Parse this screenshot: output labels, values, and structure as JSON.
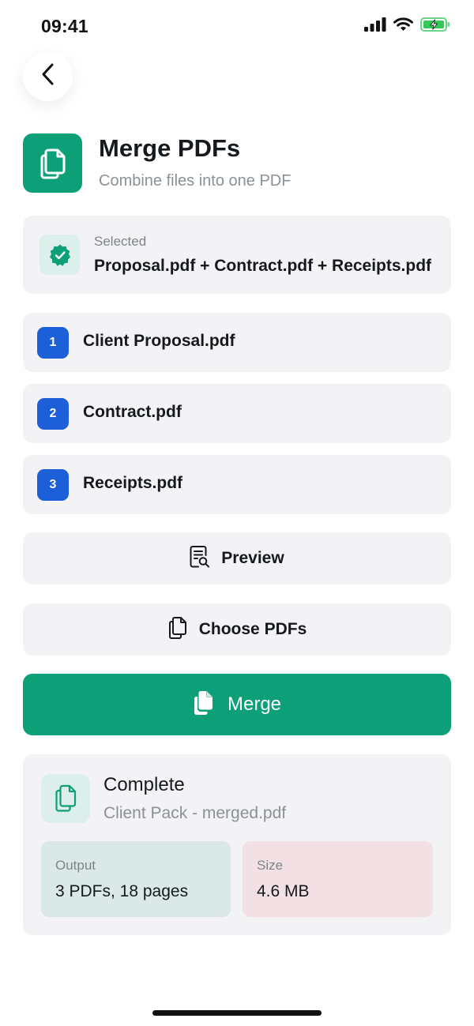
{
  "status_bar": {
    "time": "09:41"
  },
  "header": {
    "title": "Merge PDFs",
    "subtitle": "Combine files into one PDF",
    "icon": "documents-icon"
  },
  "selected": {
    "caption": "Selected",
    "value": "Proposal.pdf + Contract.pdf + Receipts.pdf",
    "icon": "verified-badge-icon"
  },
  "files": [
    {
      "index": "1",
      "name": "Client Proposal.pdf"
    },
    {
      "index": "2",
      "name": "Contract.pdf"
    },
    {
      "index": "3",
      "name": "Receipts.pdf"
    }
  ],
  "actions": {
    "preview_label": "Preview",
    "choose_label": "Choose PDFs",
    "merge_label": "Merge"
  },
  "result": {
    "title": "Complete",
    "file_name": "Client Pack - merged.pdf",
    "output_label": "Output",
    "output_value": "3 PDFs, 18 pages",
    "size_label": "Size",
    "size_value": "4.6 MB"
  },
  "colors": {
    "accent": "#0c9f78",
    "number_badge": "#1c5fd8",
    "card_bg": "#f3f3f6"
  }
}
